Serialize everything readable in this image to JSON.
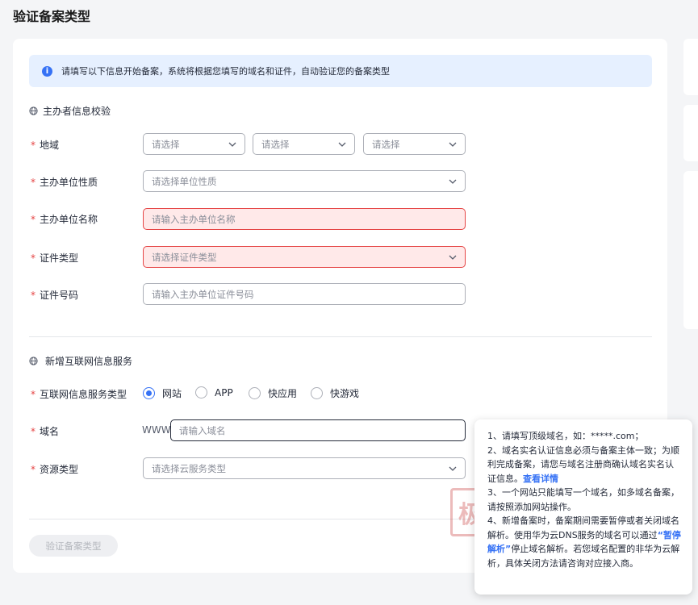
{
  "page": {
    "title": "验证备案类型"
  },
  "notice": {
    "icon": "info-icon",
    "text": "请填写以下信息开始备案，系统将根据您填写的域名和证件，自动验证您的备案类型"
  },
  "section1": {
    "title": "主办者信息校验"
  },
  "form1": {
    "region": {
      "label": "地域",
      "select1": "请选择",
      "select2": "请选择",
      "select3": "请选择"
    },
    "unit_nature": {
      "label": "主办单位性质",
      "placeholder": "请选择单位性质"
    },
    "unit_name": {
      "label": "主办单位名称",
      "placeholder": "请输入主办单位名称"
    },
    "cert_type": {
      "label": "证件类型",
      "placeholder": "请选择证件类型"
    },
    "cert_no": {
      "label": "证件号码",
      "placeholder": "请输入主办单位证件号码"
    }
  },
  "section2": {
    "title": "新增互联网信息服务"
  },
  "form2": {
    "service_type": {
      "label": "互联网信息服务类型",
      "options": [
        "网站",
        "APP",
        "快应用",
        "快游戏"
      ],
      "selected": "网站"
    },
    "domain": {
      "label": "域名",
      "prefix": "WWW",
      "placeholder": "请输入域名"
    },
    "resource": {
      "label": "资源类型",
      "placeholder": "请选择云服务类型"
    }
  },
  "buttons": {
    "verify": "验证备案类型"
  },
  "tooltip": {
    "line1": "1、请填写顶级域名，如：*****.com；",
    "line2a": "2、域名实名认证信息必须与备案主体一致；为顺利完成备案，请您与域名注册商确认域名实名认证信息。",
    "line2_link": "查看详情",
    "line3": "3、一个网站只能填写一个域名，如多域名备案，请按照添加网站操作。",
    "line4a": "4、新增备案时，备案期间需要暂停或者关闭域名解析。使用华为云DNS服务的域名可以通过",
    "line4_link": "“暂停解析”",
    "line4b": "停止域名解析。若您域名配置的非华为云解析，具体关闭方法请咨询对应接入商。"
  },
  "colors": {
    "primary": "#3672f5",
    "error": "#e54545",
    "notice_bg": "#e6f0ff"
  }
}
